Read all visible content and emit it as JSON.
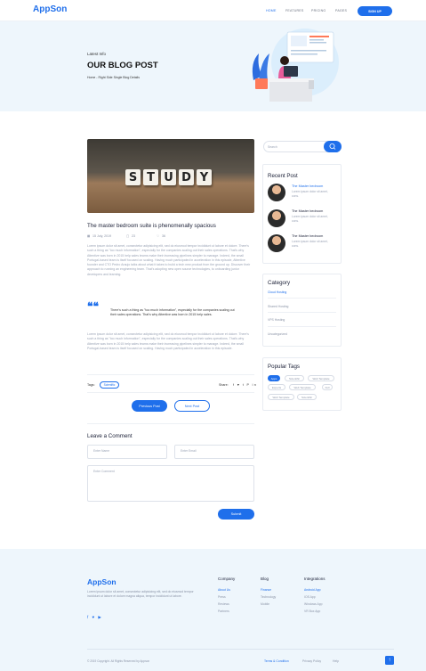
{
  "nav": {
    "logo": "AppSon",
    "links": [
      "HOME",
      "FEATURES",
      "PRICING",
      "PAGES"
    ],
    "signup": "SIGN UP"
  },
  "hero": {
    "subtitle": "Latest Info",
    "title": "OUR BLOG POST",
    "breadcrumb": "Home - Right Side Single Blog Details"
  },
  "post": {
    "image_word": [
      "S",
      "T",
      "U",
      "D",
      "Y"
    ],
    "title": "The master bedroom suite is phenomenally spacious",
    "date": "15 July, 2019",
    "comments": "23",
    "likes": "36",
    "para1": "Lorem ipsum dolor sit amet, consectetur adipisicing elit, sed do eiusmod tempor incididunt ut labore et dolore. There's such a thing as \"too much information\", especially for the companies scaling out their sales operations. That's why Attentive was born in 2015 help sales teams make their increasing pipelines simpler to manage. Indeed, the small Portugal-based team is itself focused on scaling. Having much participated in acceleration in this episode, Attentive founder and CTO Pedro Araujo talks about what it takes to build a tech new product from the ground up. Discover their approach to running an engineering team. That's adopting new open source technologies, to onboarding junior developers and learning.",
    "quote": "There's such a thing as \"too much information\", especially for the companies scaling out their sales operations. That's why Attentive was born in 2015 help sales.",
    "para2": "Lorem ipsum dolor sit amet, consectetur adipisicing elit, sed do eiusmod tempor incididunt ut labore et dolore. There's such a thing as \"too much information\", especially for the companies scaling out their sales operations. That's why Attentive was born in 2015 help sales teams make their increasing pipelines simpler to manage. Indeed, the small Portugal-based team is itself focused on scaling. Having much participated in acceleration in this episode.",
    "tags_label": "Tags:",
    "tag": "Scientific",
    "share_label": "Share:",
    "share_icons": "f ♥ t P in",
    "prev": "Previous Post",
    "next": "Next Post"
  },
  "comment": {
    "title": "Leave a Comment",
    "name_ph": "Enter Name",
    "email_ph": "Enter Email",
    "comment_ph": "Enter Comment",
    "submit": "Submit"
  },
  "sidebar": {
    "search_ph": "Search",
    "recent_title": "Recent Post",
    "recent": [
      {
        "title": "The Master bedroom",
        "text": "Lorem ipsum dolor sit amet, cons."
      },
      {
        "title": "The Master bedroom",
        "text": "Lorem ipsum dolor sit amet, cons."
      },
      {
        "title": "The Master bedroom",
        "text": "Lorem ipsum dolor sit amet, cons."
      }
    ],
    "category_title": "Category",
    "categories": [
      "Cloud Hosting",
      "Shared Hosting",
      "VPS Hosting",
      "Uncategorized"
    ],
    "tags_title": "Popular Tags",
    "tags": [
      "Apps",
      "Scientific",
      "Web Template",
      "Experts",
      "Web Template",
      "Full",
      "Web Template",
      "Scientific"
    ]
  },
  "footer": {
    "logo": "AppSon",
    "about": "Lorem ipsum dolor sit amet, consectetur adipisicing elit, sed do eiusmod tempor incididunt ut labore et dolore magna aliqua, tempor incididunt ut labore.",
    "social": "f ♥ ▶",
    "company": {
      "title": "Company",
      "links": [
        "About Us",
        "Press",
        "Reviews",
        "Partners"
      ]
    },
    "blog": {
      "title": "Blog",
      "links": [
        "Finance",
        "Technology",
        "Mobile"
      ]
    },
    "integrations": {
      "title": "Integrations",
      "links": [
        "Android App",
        "IOS App",
        "Windows App",
        "VR Box App"
      ]
    },
    "copyright": "© 2019 Copyright. All Rights Reserved by Appson",
    "terms": "Terms & Condition",
    "privacy": "Privacy Policy",
    "help": "Help",
    "back_top": "↑"
  }
}
